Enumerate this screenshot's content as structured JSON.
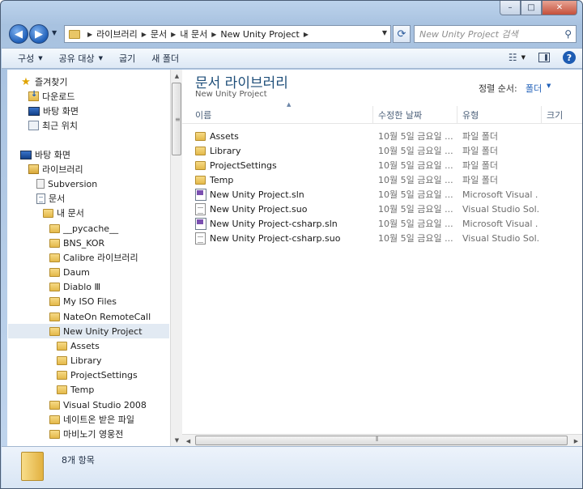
{
  "window": {
    "caption": {
      "minimize": "–",
      "maximize": "□",
      "close": "✕"
    }
  },
  "address": {
    "crumbs": [
      "라이브러리",
      "문서",
      "내 문서",
      "New Unity Project"
    ],
    "search_placeholder": "New Unity Project 검색"
  },
  "toolbar": {
    "organize": "구성",
    "share": "공유 대상",
    "burn": "굽기",
    "new_folder": "새 폴더"
  },
  "nav": {
    "items": [
      {
        "label": "즐겨찾기",
        "icon": "star-icon"
      },
      {
        "label": "다운로드",
        "icon": "downloads-folder-icon"
      },
      {
        "label": "바탕 화면",
        "icon": "desktop-icon"
      },
      {
        "label": "최근 위치",
        "icon": "recent-places-icon"
      },
      {
        "label": "바탕 화면",
        "icon": "desktop-icon"
      },
      {
        "label": "라이브러리",
        "icon": "library-icon"
      },
      {
        "label": "Subversion",
        "icon": "subversion-icon"
      },
      {
        "label": "문서",
        "icon": "documents-icon"
      },
      {
        "label": "내 문서",
        "icon": "folder-icon"
      },
      {
        "label": "__pycache__",
        "icon": "folder-icon"
      },
      {
        "label": "BNS_KOR",
        "icon": "folder-icon"
      },
      {
        "label": "Calibre 라이브러리",
        "icon": "folder-icon"
      },
      {
        "label": "Daum",
        "icon": "folder-icon"
      },
      {
        "label": "Diablo Ⅲ",
        "icon": "folder-icon"
      },
      {
        "label": "My ISO Files",
        "icon": "folder-icon"
      },
      {
        "label": "NateOn RemoteCall",
        "icon": "folder-icon"
      },
      {
        "label": "New Unity Project",
        "icon": "folder-icon",
        "selected": true
      },
      {
        "label": "Assets",
        "icon": "folder-icon"
      },
      {
        "label": "Library",
        "icon": "folder-icon"
      },
      {
        "label": "ProjectSettings",
        "icon": "folder-icon"
      },
      {
        "label": "Temp",
        "icon": "folder-icon"
      },
      {
        "label": "Visual Studio 2008",
        "icon": "folder-icon"
      },
      {
        "label": "네이트온 받은 파일",
        "icon": "folder-icon"
      },
      {
        "label": "마비노기 영웅전",
        "icon": "folder-icon"
      }
    ]
  },
  "content": {
    "library_title": "문서 라이브러리",
    "library_subtitle": "New Unity Project",
    "arrange_label": "정렬 순서:",
    "arrange_value": "폴더",
    "columns": [
      "이름",
      "수정한 날짜",
      "유형",
      "크기"
    ],
    "files": [
      {
        "name": "Assets",
        "date": "10월 5일 금요일 ...",
        "type": "파일 폴더",
        "icon": "folder-icon"
      },
      {
        "name": "Library",
        "date": "10월 5일 금요일 ...",
        "type": "파일 폴더",
        "icon": "folder-icon"
      },
      {
        "name": "ProjectSettings",
        "date": "10월 5일 금요일 ...",
        "type": "파일 폴더",
        "icon": "folder-icon"
      },
      {
        "name": "Temp",
        "date": "10월 5일 금요일 ...",
        "type": "파일 폴더",
        "icon": "folder-icon"
      },
      {
        "name": "New Unity Project.sln",
        "date": "10월 5일 금요일 ...",
        "type": "Microsoft Visual ...",
        "icon": "solution-file-icon"
      },
      {
        "name": "New Unity Project.suo",
        "date": "10월 5일 금요일 ...",
        "type": "Visual Studio Sol...",
        "icon": "suo-file-icon"
      },
      {
        "name": "New Unity Project-csharp.sln",
        "date": "10월 5일 금요일 ...",
        "type": "Microsoft Visual ...",
        "icon": "solution-file-icon"
      },
      {
        "name": "New Unity Project-csharp.suo",
        "date": "10월 5일 금요일 ...",
        "type": "Visual Studio Sol...",
        "icon": "suo-file-icon"
      }
    ]
  },
  "status": {
    "item_count": "8개 항목"
  }
}
